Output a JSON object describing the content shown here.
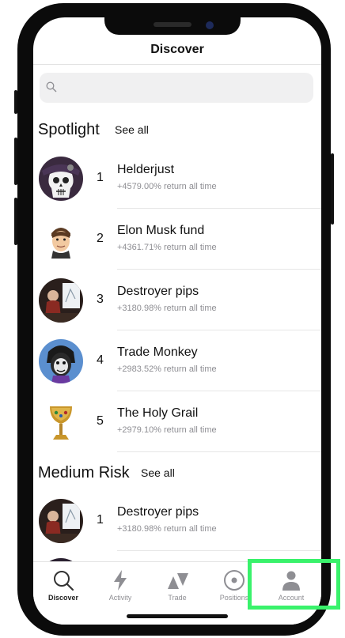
{
  "nav": {
    "title": "Discover"
  },
  "search": {
    "placeholder": ""
  },
  "spotlight": {
    "title": "Spotlight",
    "see_all": "See all",
    "items": [
      {
        "rank": "1",
        "name": "Helderjust",
        "ret": "+4579.00% return all time",
        "avatar": "skull-avatar-icon"
      },
      {
        "rank": "2",
        "name": "Elon Musk fund",
        "ret": "+4361.71% return all time",
        "avatar": "cartoon-face-avatar-icon"
      },
      {
        "rank": "3",
        "name": "Destroyer pips",
        "ret": "+3180.98% return all time",
        "avatar": "painter-avatar-icon"
      },
      {
        "rank": "4",
        "name": "Trade Monkey",
        "ret": "+2983.52% return all time",
        "avatar": "monkey-avatar-icon"
      },
      {
        "rank": "5",
        "name": "The Holy Grail",
        "ret": "+2979.10% return all time",
        "avatar": "grail-avatar-icon"
      }
    ]
  },
  "medium_risk": {
    "title": "Medium Risk",
    "see_all": "See all",
    "items": [
      {
        "rank": "1",
        "name": "Destroyer pips",
        "ret": "+3180.98% return all time",
        "avatar": "painter-avatar-icon"
      }
    ]
  },
  "tabs": [
    {
      "label": "Discover",
      "icon": "search-icon",
      "active": true
    },
    {
      "label": "Activity",
      "icon": "lightning-icon",
      "active": false
    },
    {
      "label": "Trade",
      "icon": "trade-arrows-icon",
      "active": false
    },
    {
      "label": "Positions",
      "icon": "target-icon",
      "active": false
    },
    {
      "label": "Account",
      "icon": "person-icon",
      "active": false
    }
  ],
  "highlight_color": "#39f26b"
}
